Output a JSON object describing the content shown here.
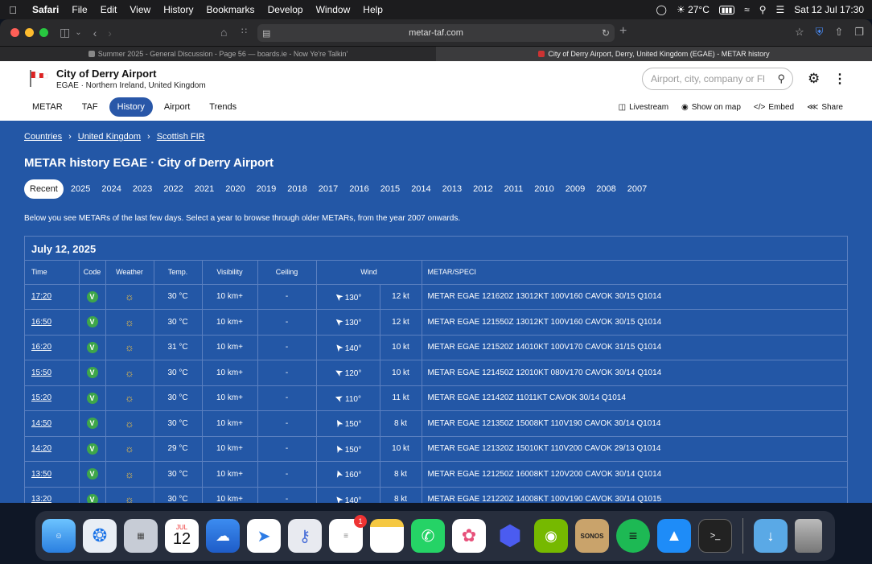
{
  "menubar": {
    "app": "Safari",
    "items": [
      "File",
      "Edit",
      "View",
      "History",
      "Bookmarks",
      "Develop",
      "Window",
      "Help"
    ],
    "temp": "27°C",
    "datetime": "Sat 12 Jul  17:30"
  },
  "browser": {
    "url": "metar-taf.com",
    "tabs": [
      {
        "title": "Summer 2025 - General Discussion - Page 56 — boards.ie - Now Ye're Talkin'"
      },
      {
        "title": "City of Derry Airport, Derry, United Kingdom (EGAE) - METAR history"
      }
    ]
  },
  "header": {
    "airport_name": "City of Derry Airport",
    "airport_sub": "EGAE · Northern Ireland, United Kingdom",
    "search_placeholder": "Airport, city, company or Fl",
    "nav": [
      "METAR",
      "TAF",
      "History",
      "Airport",
      "Trends"
    ],
    "nav_active": "History",
    "actions": [
      {
        "label": "Livestream",
        "icon": "tv-icon"
      },
      {
        "label": "Show on map",
        "icon": "map-pin-icon"
      },
      {
        "label": "Embed",
        "icon": "code-icon"
      },
      {
        "label": "Share",
        "icon": "share-icon"
      }
    ]
  },
  "content": {
    "breadcrumb": [
      "Countries",
      "United Kingdom",
      "Scottish FIR"
    ],
    "title": "METAR history EGAE · City of Derry Airport",
    "years": [
      "Recent",
      "2025",
      "2024",
      "2023",
      "2022",
      "2021",
      "2020",
      "2019",
      "2018",
      "2017",
      "2016",
      "2015",
      "2014",
      "2013",
      "2012",
      "2011",
      "2010",
      "2009",
      "2008",
      "2007"
    ],
    "intro": "Below you see METARs of the last few days. Select a year to browse through older METARs, from the year 2007 onwards.",
    "date": "July 12, 2025",
    "columns": [
      "Time",
      "Code",
      "Weather",
      "Temp.",
      "Visibility",
      "Ceiling",
      "Wind",
      "METAR/SPECI"
    ],
    "rows": [
      {
        "time": "17:20",
        "code": "V",
        "temp": "30 °C",
        "vis": "10 km+",
        "ceiling": "-",
        "dir": "130°",
        "dir_deg": 130,
        "speed": "12 kt",
        "metar": "METAR EGAE 121620Z 13012KT 100V160 CAVOK 30/15 Q1014"
      },
      {
        "time": "16:50",
        "code": "V",
        "temp": "30 °C",
        "vis": "10 km+",
        "ceiling": "-",
        "dir": "130°",
        "dir_deg": 130,
        "speed": "12 kt",
        "metar": "METAR EGAE 121550Z 13012KT 100V160 CAVOK 30/15 Q1014"
      },
      {
        "time": "16:20",
        "code": "V",
        "temp": "31 °C",
        "vis": "10 km+",
        "ceiling": "-",
        "dir": "140°",
        "dir_deg": 140,
        "speed": "10 kt",
        "metar": "METAR EGAE 121520Z 14010KT 100V170 CAVOK 31/15 Q1014"
      },
      {
        "time": "15:50",
        "code": "V",
        "temp": "30 °C",
        "vis": "10 km+",
        "ceiling": "-",
        "dir": "120°",
        "dir_deg": 120,
        "speed": "10 kt",
        "metar": "METAR EGAE 121450Z 12010KT 080V170 CAVOK 30/14 Q1014"
      },
      {
        "time": "15:20",
        "code": "V",
        "temp": "30 °C",
        "vis": "10 km+",
        "ceiling": "-",
        "dir": "110°",
        "dir_deg": 110,
        "speed": "11 kt",
        "metar": "METAR EGAE 121420Z 11011KT CAVOK 30/14 Q1014"
      },
      {
        "time": "14:50",
        "code": "V",
        "temp": "30 °C",
        "vis": "10 km+",
        "ceiling": "-",
        "dir": "150°",
        "dir_deg": 150,
        "speed": "8 kt",
        "metar": "METAR EGAE 121350Z 15008KT 110V190 CAVOK 30/14 Q1014"
      },
      {
        "time": "14:20",
        "code": "V",
        "temp": "29 °C",
        "vis": "10 km+",
        "ceiling": "-",
        "dir": "150°",
        "dir_deg": 150,
        "speed": "10 kt",
        "metar": "METAR EGAE 121320Z 15010KT 110V200 CAVOK 29/13 Q1014"
      },
      {
        "time": "13:50",
        "code": "V",
        "temp": "30 °C",
        "vis": "10 km+",
        "ceiling": "-",
        "dir": "160°",
        "dir_deg": 160,
        "speed": "8 kt",
        "metar": "METAR EGAE 121250Z 16008KT 120V200 CAVOK 30/14 Q1014"
      },
      {
        "time": "13:20",
        "code": "V",
        "temp": "30 °C",
        "vis": "10 km+",
        "ceiling": "-",
        "dir": "140°",
        "dir_deg": 140,
        "speed": "8 kt",
        "metar": "METAR EGAE 121220Z 14008KT 100V190 CAVOK 30/14 Q1015"
      }
    ]
  },
  "dock": {
    "calendar_month": "JUL",
    "calendar_day": "12",
    "reminders_badge": "1",
    "sonos_label": "SONOS",
    "apps": [
      "finder",
      "safari",
      "launchpad",
      "calendar",
      "weather",
      "copilot",
      "keychain",
      "reminders",
      "notes",
      "whatsapp",
      "photos",
      "prism",
      "nvidia",
      "sonos",
      "spotify",
      "app-store",
      "terminal",
      "downloads",
      "trash"
    ]
  }
}
